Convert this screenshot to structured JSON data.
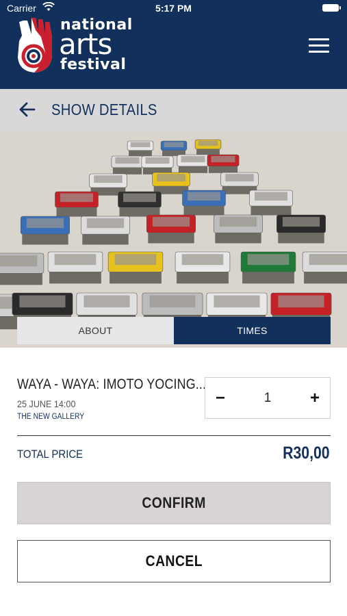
{
  "status_bar": {
    "carrier": "Carrier",
    "time": "5:17 PM"
  },
  "header": {
    "logo_line1": "national",
    "logo_line2": "arts",
    "logo_line3": "festival",
    "menu_icon": "hamburger-icon",
    "background_color": "#12305c"
  },
  "sub_header": {
    "back_icon": "arrow-left-icon",
    "title": "SHOW DETAILS"
  },
  "tabs": [
    {
      "label": "ABOUT",
      "active": false
    },
    {
      "label": "TIMES",
      "active": true
    }
  ],
  "booking": {
    "show_name": "WAYA - WAYA: IMOTO YOCING...",
    "date_time": "25 JUNE 14:00",
    "venue": "THE NEW GALLERY",
    "quantity": "1",
    "minus_label": "−",
    "plus_label": "+",
    "total_label": "TOTAL PRICE",
    "total_value": "R30,00"
  },
  "actions": {
    "confirm_label": "CONFIRM",
    "cancel_label": "CANCEL"
  },
  "colors": {
    "brand_navy": "#12305c",
    "confirm_bg": "#d9d4d4"
  }
}
